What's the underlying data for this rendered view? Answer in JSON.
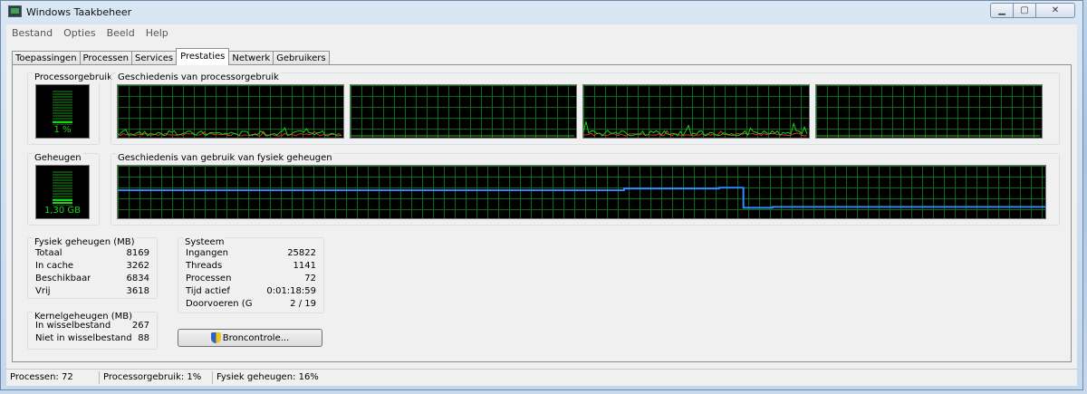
{
  "window": {
    "title": "Windows Taakbeheer",
    "minimize": "▁",
    "maximize": "▢",
    "close": "✕"
  },
  "menu": [
    "Bestand",
    "Opties",
    "Beeld",
    "Help"
  ],
  "tabs": [
    "Toepassingen",
    "Processen",
    "Services",
    "Prestaties",
    "Netwerk",
    "Gebruikers"
  ],
  "active_tab": "Prestaties",
  "cpu": {
    "title": "Processorgebruik",
    "value": "1 %",
    "level": 0.01
  },
  "cpu_history": {
    "title": "Geschiedenis van processorgebruik"
  },
  "memory": {
    "title": "Geheugen",
    "value": "1,30 GB",
    "level": 0.16
  },
  "memory_history": {
    "title": "Geschiedenis van gebruik van fysiek geheugen"
  },
  "physical_memory": {
    "title": "Fysiek geheugen (MB)",
    "rows": [
      {
        "label": "Totaal",
        "value": "8169"
      },
      {
        "label": "In cache",
        "value": "3262"
      },
      {
        "label": "Beschikbaar",
        "value": "6834"
      },
      {
        "label": "Vrij",
        "value": "3618"
      }
    ]
  },
  "kernel_memory": {
    "title": "Kernelgeheugen (MB)",
    "rows": [
      {
        "label": "In wisselbestand",
        "value": "267"
      },
      {
        "label": "Niet in wisselbestand",
        "value": "88"
      }
    ]
  },
  "system": {
    "title": "Systeem",
    "rows": [
      {
        "label": "Ingangen",
        "value": "25822"
      },
      {
        "label": "Threads",
        "value": "1141"
      },
      {
        "label": "Processen",
        "value": "72"
      },
      {
        "label": "Tijd actief",
        "value": "0:01:18:59"
      },
      {
        "label": "Doorvoeren (G",
        "value": "2 / 19"
      }
    ]
  },
  "resource_monitor_button": "Broncontrole...",
  "status": {
    "processes": "Processen: 72",
    "cpu": "Processorgebruik: 1%",
    "memory": "Fysiek geheugen: 16%"
  },
  "colors": {
    "graph_line_green": "#17d417",
    "graph_line_red": "#e23030",
    "memory_line": "#2f8cff"
  }
}
